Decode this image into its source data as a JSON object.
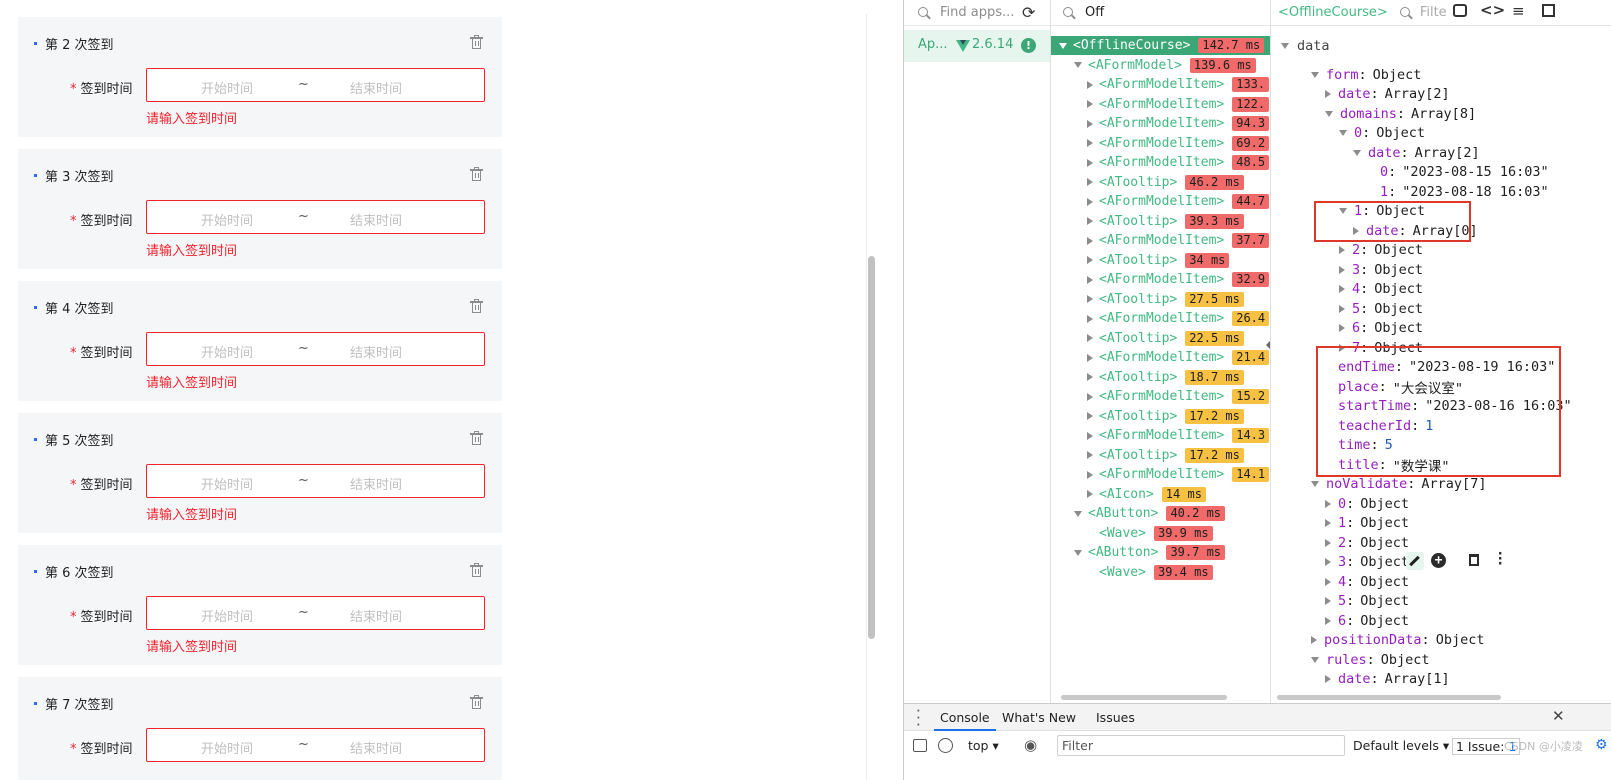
{
  "form": {
    "cards": [
      {
        "title": "第 2 次签到",
        "label": "签到时间",
        "start_placeholder": "开始时间",
        "end_placeholder": "结束时间",
        "separator": "~",
        "error": "请输入签到时间"
      },
      {
        "title": "第 3 次签到",
        "label": "签到时间",
        "start_placeholder": "开始时间",
        "end_placeholder": "结束时间",
        "separator": "~",
        "error": "请输入签到时间"
      },
      {
        "title": "第 4 次签到",
        "label": "签到时间",
        "start_placeholder": "开始时间",
        "end_placeholder": "结束时间",
        "separator": "~",
        "error": "请输入签到时间"
      },
      {
        "title": "第 5 次签到",
        "label": "签到时间",
        "start_placeholder": "开始时间",
        "end_placeholder": "结束时间",
        "separator": "~",
        "error": "请输入签到时间"
      },
      {
        "title": "第 6 次签到",
        "label": "签到时间",
        "start_placeholder": "开始时间",
        "end_placeholder": "结束时间",
        "separator": "~",
        "error": "请输入签到时间"
      },
      {
        "title": "第 7 次签到",
        "label": "签到时间",
        "start_placeholder": "开始时间",
        "end_placeholder": "结束时间",
        "separator": "~",
        "error": ""
      }
    ],
    "required_mark": "*"
  },
  "devtools": {
    "apps": {
      "search_placeholder": "Find apps...",
      "app_name": "Ap...",
      "vue_version": "2.6.14",
      "warn": "!"
    },
    "tree": {
      "search_value": "Off",
      "rows": [
        {
          "name": "<OfflineCourse>",
          "time": "142.7 ms",
          "color": "red",
          "arrow": "open",
          "selected": true
        },
        {
          "name": "<AFormModel>",
          "time": "139.6 ms",
          "color": "red",
          "arrow": "open"
        },
        {
          "name": "<AFormModelItem>",
          "time": "133.",
          "color": "red",
          "arrow": "closed"
        },
        {
          "name": "<AFormModelItem>",
          "time": "122.",
          "color": "red",
          "arrow": "closed"
        },
        {
          "name": "<AFormModelItem>",
          "time": "94.3",
          "color": "red",
          "arrow": "closed"
        },
        {
          "name": "<AFormModelItem>",
          "time": "69.2",
          "color": "red",
          "arrow": "closed"
        },
        {
          "name": "<AFormModelItem>",
          "time": "48.5",
          "color": "red",
          "arrow": "closed"
        },
        {
          "name": "<ATooltip>",
          "time": "46.2 ms",
          "color": "red",
          "arrow": "closed"
        },
        {
          "name": "<AFormModelItem>",
          "time": "44.7",
          "color": "red",
          "arrow": "closed"
        },
        {
          "name": "<ATooltip>",
          "time": "39.3 ms",
          "color": "red",
          "arrow": "closed"
        },
        {
          "name": "<AFormModelItem>",
          "time": "37.7",
          "color": "red",
          "arrow": "closed"
        },
        {
          "name": "<ATooltip>",
          "time": "34 ms",
          "color": "red",
          "arrow": "closed"
        },
        {
          "name": "<AFormModelItem>",
          "time": "32.9",
          "color": "red",
          "arrow": "closed"
        },
        {
          "name": "<ATooltip>",
          "time": "27.5 ms",
          "color": "yellow",
          "arrow": "closed"
        },
        {
          "name": "<AFormModelItem>",
          "time": "26.4",
          "color": "yellow",
          "arrow": "closed"
        },
        {
          "name": "<ATooltip>",
          "time": "22.5 ms",
          "color": "yellow",
          "arrow": "closed"
        },
        {
          "name": "<AFormModelItem>",
          "time": "21.4",
          "color": "yellow",
          "arrow": "closed"
        },
        {
          "name": "<ATooltip>",
          "time": "18.7 ms",
          "color": "yellow",
          "arrow": "closed"
        },
        {
          "name": "<AFormModelItem>",
          "time": "15.2",
          "color": "yellow",
          "arrow": "closed"
        },
        {
          "name": "<ATooltip>",
          "time": "17.2 ms",
          "color": "yellow",
          "arrow": "closed"
        },
        {
          "name": "<AFormModelItem>",
          "time": "14.3",
          "color": "yellow",
          "arrow": "closed"
        },
        {
          "name": "<ATooltip>",
          "time": "17.2 ms",
          "color": "yellow",
          "arrow": "closed"
        },
        {
          "name": "<AFormModelItem>",
          "time": "14.1",
          "color": "yellow",
          "arrow": "closed"
        },
        {
          "name": "<AIcon>",
          "time": "14 ms",
          "color": "yellow",
          "arrow": "closed"
        },
        {
          "name": "<AButton>",
          "time": "40.2 ms",
          "color": "red",
          "arrow": "open"
        },
        {
          "name": "<Wave>",
          "time": "39.9 ms",
          "color": "red",
          "arrow": "none"
        },
        {
          "name": "<AButton>",
          "time": "39.7 ms",
          "color": "red",
          "arrow": "open"
        },
        {
          "name": "<Wave>",
          "time": "39.4 ms",
          "color": "red",
          "arrow": "none"
        }
      ]
    },
    "state": {
      "component_name": "<OfflineCourse>",
      "filter_placeholder": "Filte",
      "section": "data",
      "rows": [
        {
          "key": "form",
          "value": "Object",
          "arrow": "open",
          "type": "obj"
        },
        {
          "key": "date",
          "value": "Array[2]",
          "arrow": "closed",
          "type": "obj"
        },
        {
          "key": "domains",
          "value": "Array[8]",
          "arrow": "open",
          "type": "obj"
        },
        {
          "key": "0",
          "value": "Object",
          "arrow": "open",
          "type": "obj"
        },
        {
          "key": "date",
          "value": "Array[2]",
          "arrow": "open",
          "type": "obj"
        },
        {
          "key": "0",
          "value": "\"2023-08-15 16:03\"",
          "arrow": "none",
          "type": "str"
        },
        {
          "key": "1",
          "value": "\"2023-08-18 16:03\"",
          "arrow": "none",
          "type": "str"
        },
        {
          "key": "1",
          "value": "Object",
          "arrow": "open",
          "type": "obj"
        },
        {
          "key": "date",
          "value": "Array[0]",
          "arrow": "closed",
          "type": "obj"
        },
        {
          "key": "2",
          "value": "Object",
          "arrow": "closed",
          "type": "obj"
        },
        {
          "key": "3",
          "value": "Object",
          "arrow": "closed",
          "type": "obj"
        },
        {
          "key": "4",
          "value": "Object",
          "arrow": "closed",
          "type": "obj"
        },
        {
          "key": "5",
          "value": "Object",
          "arrow": "closed",
          "type": "obj"
        },
        {
          "key": "6",
          "value": "Object",
          "arrow": "closed",
          "type": "obj"
        },
        {
          "key": "7",
          "value": "Object",
          "arrow": "closed",
          "type": "obj"
        },
        {
          "key": "endTime",
          "value": "\"2023-08-19 16:03\"",
          "arrow": "none",
          "type": "str"
        },
        {
          "key": "place",
          "value": "\"大会议室\"",
          "arrow": "none",
          "type": "str"
        },
        {
          "key": "startTime",
          "value": "\"2023-08-16 16:03\"",
          "arrow": "none",
          "type": "str"
        },
        {
          "key": "teacherId",
          "value": "1",
          "arrow": "none",
          "type": "num"
        },
        {
          "key": "time",
          "value": "5",
          "arrow": "none",
          "type": "num"
        },
        {
          "key": "title",
          "value": "\"数学课\"",
          "arrow": "none",
          "type": "str"
        },
        {
          "key": "noValidate",
          "value": "Array[7]",
          "arrow": "open",
          "type": "obj"
        },
        {
          "key": "0",
          "value": "Object",
          "arrow": "closed",
          "type": "obj"
        },
        {
          "key": "1",
          "value": "Object",
          "arrow": "closed",
          "type": "obj"
        },
        {
          "key": "2",
          "value": "Object",
          "arrow": "closed",
          "type": "obj"
        },
        {
          "key": "3",
          "value": "Object",
          "arrow": "closed",
          "type": "obj"
        },
        {
          "key": "4",
          "value": "Object",
          "arrow": "closed",
          "type": "obj"
        },
        {
          "key": "5",
          "value": "Object",
          "arrow": "closed",
          "type": "obj"
        },
        {
          "key": "6",
          "value": "Object",
          "arrow": "closed",
          "type": "obj"
        },
        {
          "key": "positionData",
          "value": "Object",
          "arrow": "closed",
          "type": "obj"
        },
        {
          "key": "rules",
          "value": "Object",
          "arrow": "open",
          "type": "obj"
        },
        {
          "key": "date",
          "value": "Array[1]",
          "arrow": "closed",
          "type": "obj"
        }
      ]
    },
    "drawer": {
      "tabs": [
        "Console",
        "What's New",
        "Issues"
      ],
      "active_tab": "Console",
      "context": "top",
      "filter_placeholder": "Filter",
      "levels": "Default levels",
      "issues": "1 Issue:",
      "issues_count": "1",
      "watermark": "CSDN @小凌凌"
    }
  },
  "colors": {
    "accent": "#42b983",
    "error": "#f5222d",
    "badge_red": "#f06a6a",
    "badge_yellow": "#f6c042",
    "key": "#951ebf",
    "highlight_box": "#e0372b"
  }
}
